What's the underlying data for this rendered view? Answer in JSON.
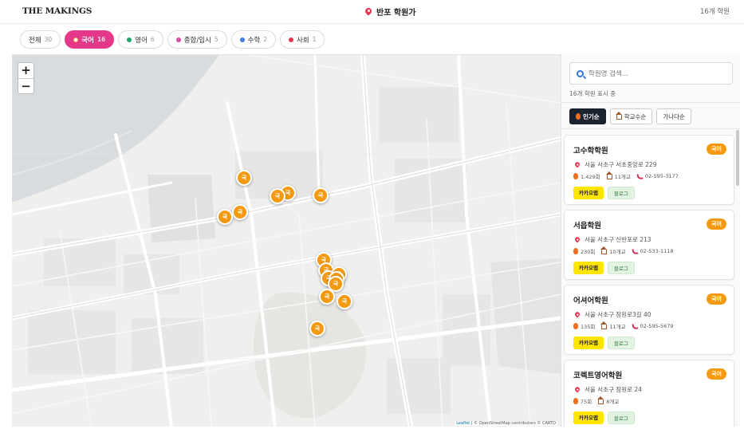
{
  "header": {
    "logo": "THE MAKINGS",
    "title": "반포 학원가",
    "count": "16개 학원"
  },
  "filters": [
    {
      "label": "전체",
      "count": "30",
      "color": "",
      "active": false
    },
    {
      "label": "국어",
      "count": "16",
      "color": "#ffffff",
      "active": true
    },
    {
      "label": "영어",
      "count": "6",
      "color": "#1fa36b",
      "active": false
    },
    {
      "label": "종합/입시",
      "count": "5",
      "color": "#d94aa0",
      "active": false
    },
    {
      "label": "수학",
      "count": "2",
      "color": "#3a7ee0",
      "active": false
    },
    {
      "label": "사회",
      "count": "1",
      "color": "#e8344e",
      "active": false
    }
  ],
  "map": {
    "zoom_in": "+",
    "zoom_out": "−",
    "marker_label": "국",
    "marker_color": "#f39a10",
    "attribution_leaflet": "Leaflet",
    "attribution_rest": " | © OpenStreetMap contributors © CARTO"
  },
  "panel": {
    "search_placeholder": "학원명 검색...",
    "showing": "16개 학원 표시 중",
    "sorts": [
      {
        "label": "인기순",
        "icon": "fire-icon",
        "active": true
      },
      {
        "label": "학교수순",
        "icon": "school-icon",
        "active": false
      },
      {
        "label": "가나다순",
        "icon": "",
        "active": false
      }
    ]
  },
  "academies": [
    {
      "name": "고수학학원",
      "subject": "국어",
      "address": "서울 서초구 서초중앙로 229",
      "views": "1,429회",
      "schools": "11개교",
      "phone": "02-595-3177",
      "kakao": "카카오맵",
      "blog": "블로그"
    },
    {
      "name": "서읍학원",
      "subject": "국어",
      "address": "서울 서초구 신반포로 213",
      "views": "230회",
      "schools": "10개교",
      "phone": "02-533-1118",
      "kakao": "카카오맵",
      "blog": "블로그"
    },
    {
      "name": "어셔어학원",
      "subject": "국어",
      "address": "서울 서초구 잠원로3길 40",
      "views": "135회",
      "schools": "11개교",
      "phone": "02-595-5679",
      "kakao": "카카오맵",
      "blog": "블로그"
    },
    {
      "name": "코렉트영어학원",
      "subject": "국어",
      "address": "서울 서초구 잠원로 24",
      "views": "75회",
      "schools": "8개교",
      "phone": "",
      "kakao": "카카오맵",
      "blog": "블로그"
    }
  ]
}
